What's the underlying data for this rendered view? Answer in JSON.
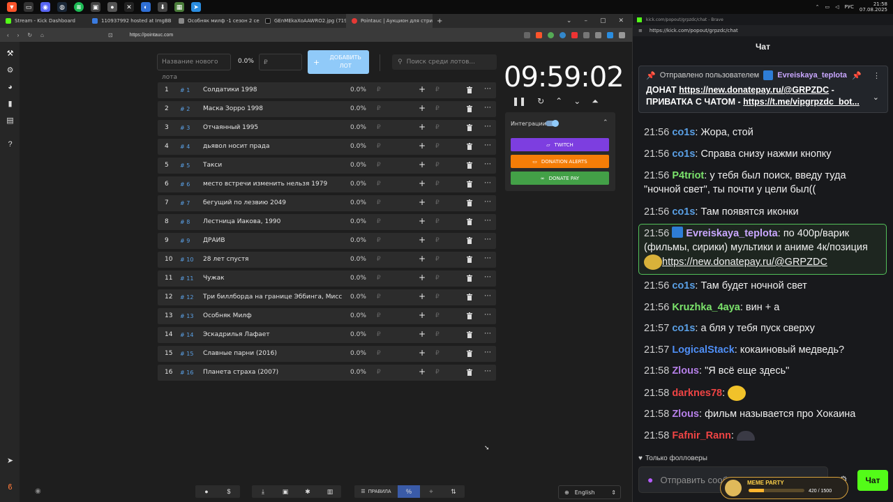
{
  "taskbar": {
    "lang": "РУС",
    "time": "21:58",
    "date": "07.08.2025"
  },
  "browser": {
    "tabs": [
      {
        "label": "Stream - Kick Dashboard"
      },
      {
        "label": "110937992 hosted at ImgBB — Img"
      },
      {
        "label": "Особняк милф -1 сезон 2 серия / "
      },
      {
        "label": "GEnMEkaXoAAWRO2.jpg (719×876)"
      },
      {
        "label": "Pointauc | Аукцион для стримера"
      }
    ],
    "url": "https://pointauc.com"
  },
  "toolbar": {
    "lot_name_placeholder": "Название нового лота",
    "percent": "0.0%",
    "rub_placeholder": "₽",
    "add_btn_line1": "ДОБАВИТЬ",
    "add_btn_line2": "ЛОТ",
    "search_placeholder": "Поиск среди лотов..."
  },
  "lots": [
    {
      "n": "1",
      "id": "# 1",
      "name": "Солдатики 1998",
      "pct": "0.0%"
    },
    {
      "n": "2",
      "id": "# 2",
      "name": "Маска Зорро 1998",
      "pct": "0.0%"
    },
    {
      "n": "3",
      "id": "# 3",
      "name": "Отчаянный 1995",
      "pct": "0.0%"
    },
    {
      "n": "4",
      "id": "# 4",
      "name": "дьявол носит прада",
      "pct": "0.0%"
    },
    {
      "n": "5",
      "id": "# 5",
      "name": "Такси",
      "pct": "0.0%"
    },
    {
      "n": "6",
      "id": "# 6",
      "name": "место встречи изменить нельзя 1979",
      "pct": "0.0%"
    },
    {
      "n": "7",
      "id": "# 7",
      "name": "бегущий по лезвию 2049",
      "pct": "0.0%"
    },
    {
      "n": "8",
      "id": "# 8",
      "name": "Лестница Иакова, 1990",
      "pct": "0.0%"
    },
    {
      "n": "9",
      "id": "# 9",
      "name": "ДРАЙВ",
      "pct": "0.0%"
    },
    {
      "n": "10",
      "id": "# 10",
      "name": "28 лет спустя",
      "pct": "0.0%"
    },
    {
      "n": "11",
      "id": "# 11",
      "name": "Чужак",
      "pct": "0.0%"
    },
    {
      "n": "12",
      "id": "# 12",
      "name": "Три биллборда на границе Эббинга, Мисс",
      "pct": "0.0%"
    },
    {
      "n": "13",
      "id": "# 13",
      "name": "Особняк Милф",
      "pct": "0.0%"
    },
    {
      "n": "14",
      "id": "# 14",
      "name": "Эскадрилья Лафает",
      "pct": "0.0%"
    },
    {
      "n": "15",
      "id": "# 15",
      "name": "Славные парни (2016)",
      "pct": "0.0%"
    },
    {
      "n": "16",
      "id": "# 16",
      "name": "Планета страха (2007)",
      "pct": "0.0%"
    }
  ],
  "lot_currency": "₽",
  "timer": "09:59:02",
  "integrations": {
    "title": "Интеграции",
    "twitch": "TWITCH",
    "donation_alerts": "DONATION ALERTS",
    "donate_pay": "DONATE PAY",
    "colors": {
      "twitch": "#7d3ee0",
      "da": "#f57d07",
      "dp": "#43a047"
    }
  },
  "bottom": {
    "rules": "ПРАВИЛА",
    "language": "English"
  },
  "kick": {
    "title_url": "kick.com/popout/grpzdc/chat - Brave",
    "url": "https://kick.com/popout/grpzdc/chat",
    "header": "Чат",
    "pinned_by": "Отправлено пользователем",
    "pinned_user": "Evreiskaya_teplota",
    "pinned_line1_a": "ДОНАТ ",
    "pinned_line1_link": "https://new.donatepay.ru/@GRPZDC",
    "pinned_line1_b": " -",
    "pinned_line2_a": "ПРИВАТКА С ЧАТОМ - ",
    "pinned_line2_link": "https://t.me/vipgrpzdc_bot...",
    "messages": [
      {
        "time": "21:56",
        "user": "co1s",
        "color": "#5aa0e6",
        "text": "Жора, стой"
      },
      {
        "time": "21:56",
        "user": "co1s",
        "color": "#5aa0e6",
        "text": "Справа снизу нажми кнопку"
      },
      {
        "time": "21:56",
        "user": "P4triot",
        "color": "#7be36b",
        "text": "у тебя был поиск, введу туда \"ночной свет\", ты почти у цели был(("
      },
      {
        "time": "21:56",
        "user": "co1s",
        "color": "#5aa0e6",
        "text": "Там появятся иконки"
      },
      {
        "time": "21:56",
        "user": "Evreiskaya_teplota",
        "color": "#c9a7ff",
        "text": "по 400р/варик (фильмы, сирики) мультики и аниме 4к/позиция",
        "link": "https://new.donatepay.ru/@GRPZDC"
      },
      {
        "time": "21:56",
        "user": "co1s",
        "color": "#5aa0e6",
        "text": "Там будет ночной свет"
      },
      {
        "time": "21:56",
        "user": "Kruzhka_4aya",
        "color": "#7be36b",
        "text": "вин + а"
      },
      {
        "time": "21:57",
        "user": "co1s",
        "color": "#5aa0e6",
        "text": "а бля у тебя пуск сверху"
      },
      {
        "time": "21:57",
        "user": "LogicalStack",
        "color": "#4f8ff7",
        "text": "кокаиновый медведь?"
      },
      {
        "time": "21:58",
        "user": "Zlous",
        "color": "#b57fe8",
        "text": "\"Я всё еще здесь\""
      },
      {
        "time": "21:58",
        "user": "darknes78",
        "color": "#ef4444",
        "text": ""
      },
      {
        "time": "21:58",
        "user": "Zlous",
        "color": "#b57fe8",
        "text": "фильм называется про Хокаина"
      },
      {
        "time": "21:58",
        "user": "Fafnir_Rann",
        "color": "#ef4444",
        "text": ""
      }
    ],
    "followers_only": "Только фолловеры",
    "input_placeholder": "Отправить сообщение...",
    "send": "Чат",
    "badge_title": "MEME PARTY",
    "badge_count": "420 / 1500",
    "badge_progress": 0.28
  }
}
